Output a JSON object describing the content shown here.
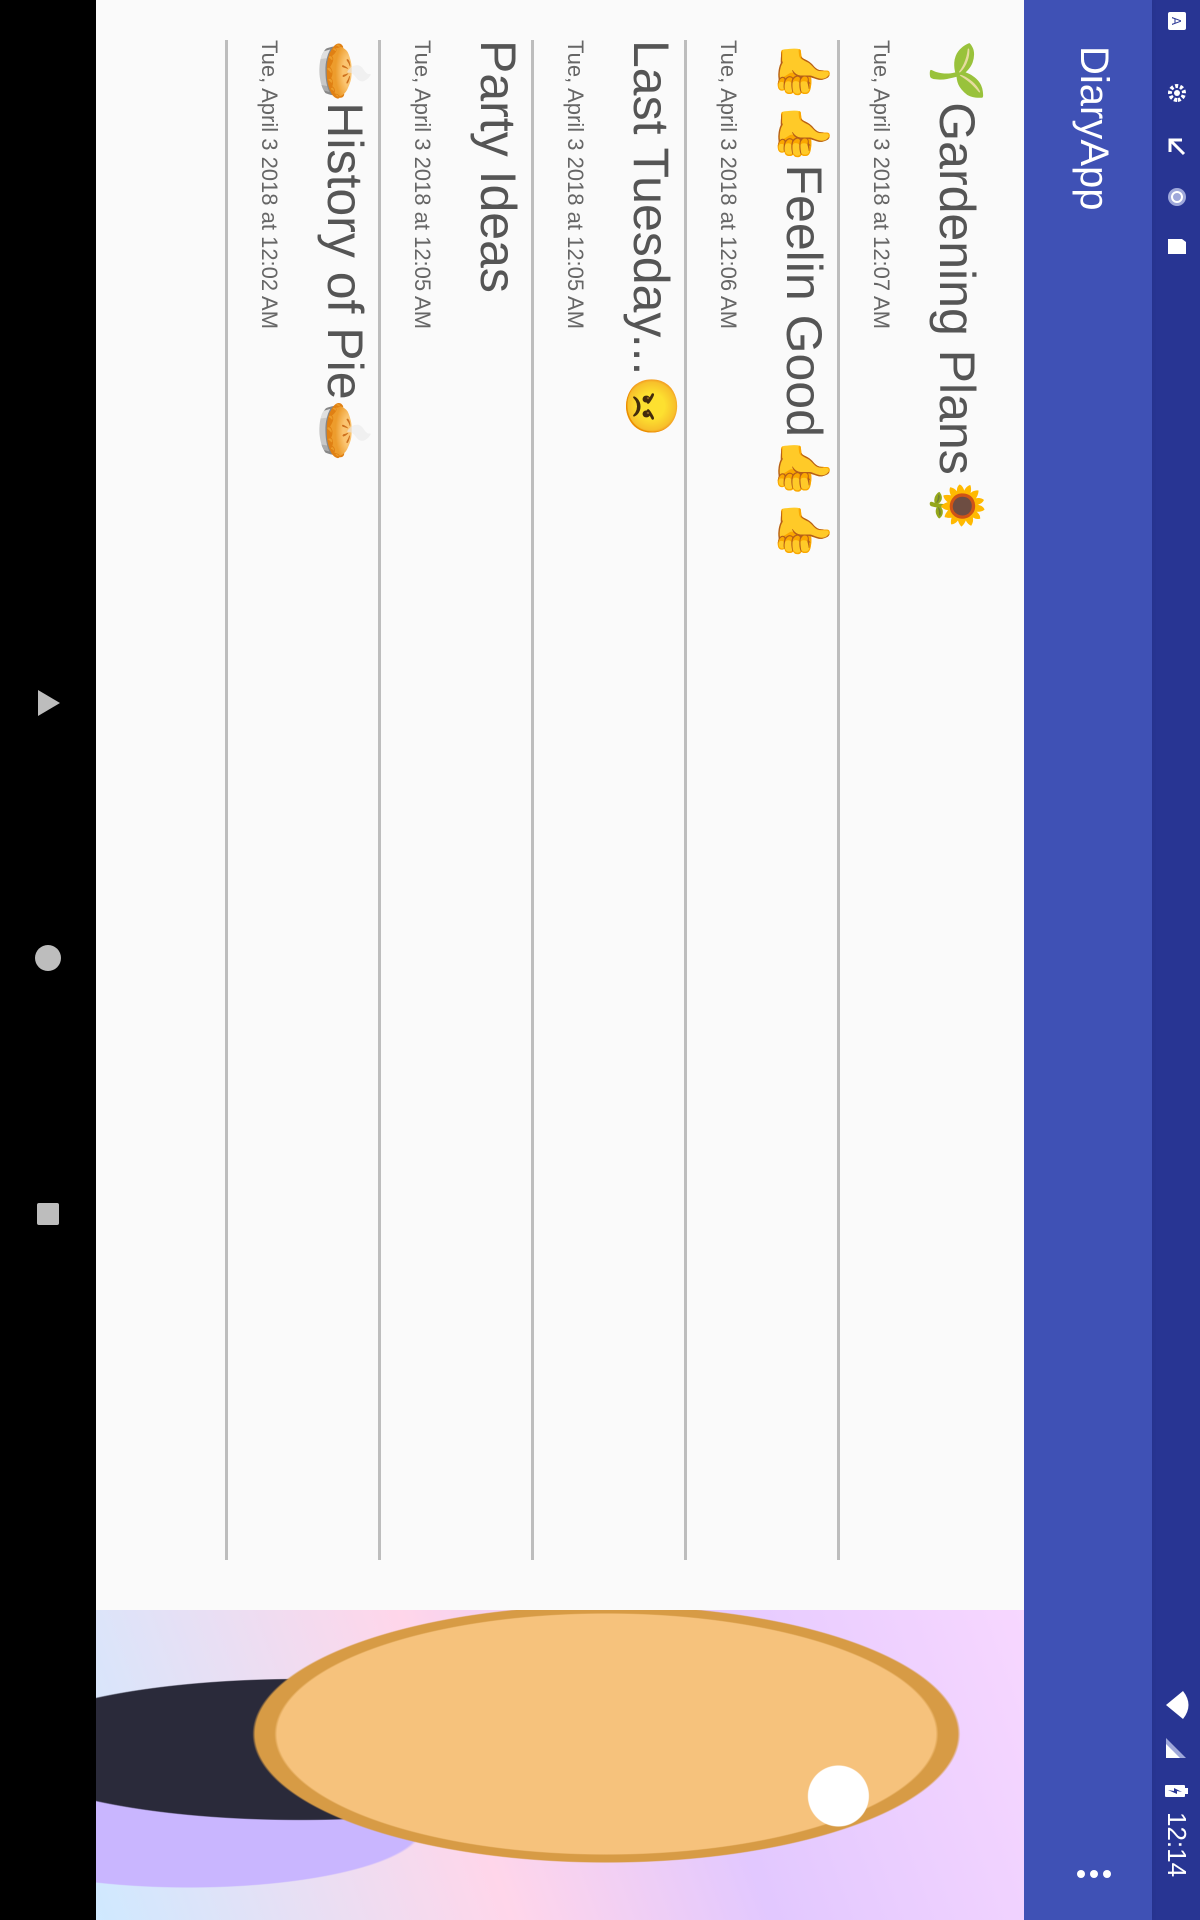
{
  "status_bar": {
    "time": "12:14",
    "icons": [
      "keyboard-icon",
      "settings-icon",
      "download-icon",
      "sync-icon",
      "sd-card-icon",
      "wifi-icon",
      "signal-icon",
      "battery-charging-icon"
    ]
  },
  "app_bar": {
    "title": "DiaryApp",
    "overflow_icon": "more-vert-icon"
  },
  "entries": [
    {
      "title": "🌱Gardening Plans🌻",
      "date": "Tue, April 3 2018 at 12:07 AM"
    },
    {
      "title": "👍👍Feelin Good👍👍",
      "date": "Tue, April 3 2018 at 12:06 AM"
    },
    {
      "title": "Last Tuesday...😠",
      "date": "Tue, April 3 2018 at 12:05 AM"
    },
    {
      "title": "Party Ideas",
      "date": "Tue, April 3 2018 at 12:05 AM"
    },
    {
      "title": "🥧History of Pie🥧",
      "date": "Tue, April 3 2018 at 12:02 AM"
    }
  ],
  "nav_bar": {
    "back_icon": "back-triangle-icon",
    "home_icon": "home-circle-icon",
    "recents_icon": "recents-square-icon"
  },
  "colors": {
    "status_bar": "#283593",
    "app_bar": "#3f51b5",
    "list_background": "#fafafa",
    "divider": "#bdbdbd"
  }
}
